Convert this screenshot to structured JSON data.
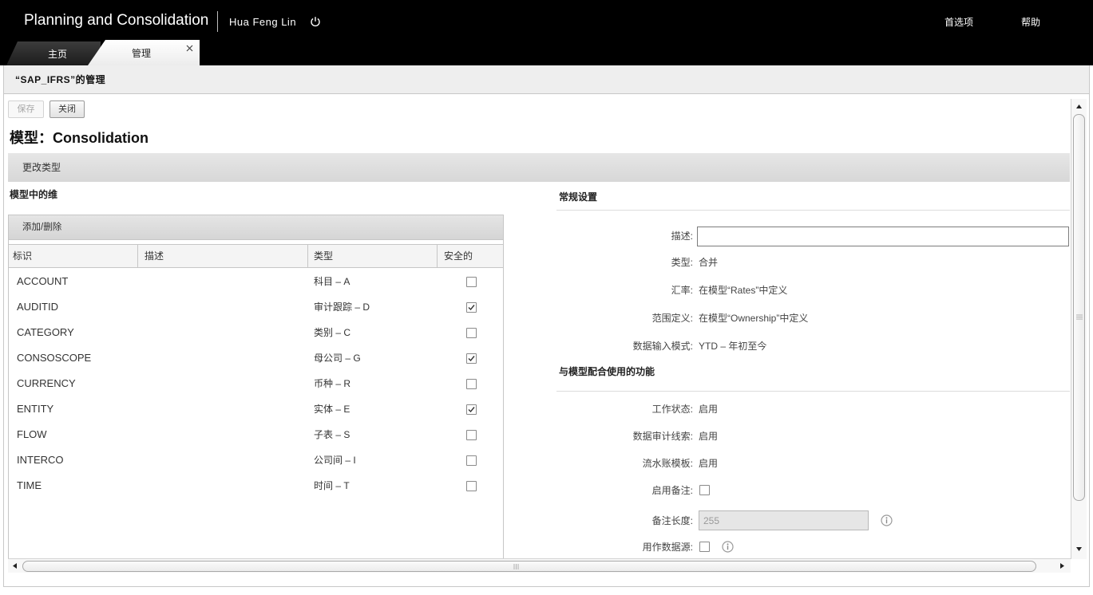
{
  "header": {
    "app_title": "Planning and Consolidation",
    "user_name": "Hua Feng Lin",
    "power_icon": "power-icon",
    "preferences_label": "首选项",
    "help_label": "帮助"
  },
  "tabs": [
    {
      "label": "主页",
      "active": false
    },
    {
      "label": "管理",
      "active": true,
      "close_icon": "close-icon"
    }
  ],
  "breadcrumb": "“SAP_IFRS”的管理",
  "toolbar": {
    "save_label": "保存",
    "save_enabled": false,
    "close_label": "关闭"
  },
  "page_title": "模型：Consolidation",
  "change_type_label": "更改类型",
  "dimensions": {
    "section_title": "模型中的维",
    "panel_title": "添加/删除",
    "columns": {
      "id": "标识",
      "description": "描述",
      "type": "类型",
      "secure": "安全的"
    },
    "rows": [
      {
        "id": "ACCOUNT",
        "type": "科目 – A",
        "secure": false
      },
      {
        "id": "AUDITID",
        "type": "审计跟踪 – D",
        "secure": true
      },
      {
        "id": "CATEGORY",
        "type": "类别 – C",
        "secure": false
      },
      {
        "id": "CONSOSCOPE",
        "type": "母公司 – G",
        "secure": true
      },
      {
        "id": "CURRENCY",
        "type": "币种 – R",
        "secure": false
      },
      {
        "id": "ENTITY",
        "type": "实体 – E",
        "secure": true
      },
      {
        "id": "FLOW",
        "type": "子表 – S",
        "secure": false
      },
      {
        "id": "INTERCO",
        "type": "公司间 – I",
        "secure": false
      },
      {
        "id": "TIME",
        "type": "时间 – T",
        "secure": false
      }
    ]
  },
  "general_settings": {
    "title": "常规设置",
    "description": {
      "label": "描述:"
    },
    "type": {
      "label": "类型:",
      "value": "合并"
    },
    "rate": {
      "label": "汇率:",
      "value": "在模型“Rates”中定义"
    },
    "scope": {
      "label": "范围定义:",
      "value": "在模型“Ownership”中定义"
    },
    "data_entry_mode": {
      "label": "数据输入模式:",
      "value": "YTD – 年初至今"
    }
  },
  "features": {
    "title": "与模型配合使用的功能",
    "work_status": {
      "label": "工作状态:",
      "value": "启用"
    },
    "data_audit": {
      "label": "数据审计线索:",
      "value": "启用"
    },
    "journal_template": {
      "label": "流水账模板:",
      "value": "启用"
    },
    "enable_comments": {
      "label": "启用备注:",
      "checked": false
    },
    "comment_length": {
      "label": "备注长度:",
      "value": "255",
      "disabled": true,
      "info_icon": "info-icon"
    },
    "use_as_source": {
      "label": "用作数据源:",
      "checked": false,
      "info_icon": "info-icon"
    }
  },
  "colors": {
    "header_bg": "#000000",
    "tab_inactive_bg": "#2e2e2e",
    "tab_active_bg": "#f3f3f3",
    "breadcrumb_bg": "#eeeeee",
    "section_bar_bg": "#dedede"
  }
}
